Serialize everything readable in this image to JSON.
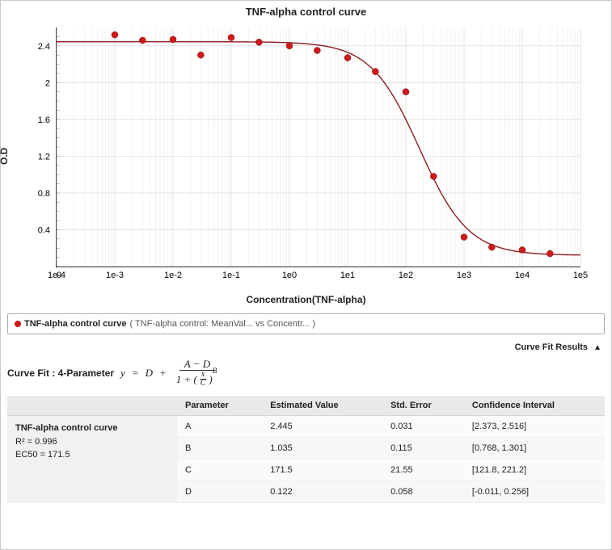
{
  "chart_data": {
    "type": "line",
    "title": "TNF-alpha control curve",
    "xlabel": "Concentration(TNF-alpha)",
    "ylabel": "O.D",
    "x_scale": "log",
    "x_ticks": [
      "1e-4",
      "1e-3",
      "1e-2",
      "1e-1",
      "1e0",
      "1e1",
      "1e2",
      "1e3",
      "1e4",
      "1e5"
    ],
    "y_ticks": [
      "0",
      "0.4",
      "0.8",
      "1.2",
      "1.6",
      "2",
      "2.4"
    ],
    "xlim": [
      0.0001,
      100000
    ],
    "ylim": [
      0,
      2.6
    ],
    "series": [
      {
        "name": "TNF-alpha control curve",
        "color": "#d11919",
        "points": [
          {
            "x": 0.001,
            "y": 2.52
          },
          {
            "x": 0.003,
            "y": 2.46
          },
          {
            "x": 0.01,
            "y": 2.47
          },
          {
            "x": 0.03,
            "y": 2.3
          },
          {
            "x": 0.1,
            "y": 2.49
          },
          {
            "x": 0.3,
            "y": 2.44
          },
          {
            "x": 1,
            "y": 2.4
          },
          {
            "x": 3,
            "y": 2.35
          },
          {
            "x": 10,
            "y": 2.27
          },
          {
            "x": 30,
            "y": 2.12
          },
          {
            "x": 100,
            "y": 1.9
          },
          {
            "x": 300,
            "y": 0.98
          },
          {
            "x": 1000,
            "y": 0.32
          },
          {
            "x": 3000,
            "y": 0.21
          },
          {
            "x": 10000,
            "y": 0.18
          },
          {
            "x": 30000,
            "y": 0.14
          }
        ],
        "fit_model": "4PL",
        "fit_params": {
          "A": 2.445,
          "B": 1.035,
          "C": 171.5,
          "D": 0.122
        }
      }
    ]
  },
  "legend": {
    "name": "TNF-alpha control curve",
    "detail": "( TNF-alpha control:  MeanVal...   vs  Concentr...  )"
  },
  "curve_fit_results_label": "Curve Fit Results",
  "curve_fit_label": "Curve Fit : 4-Parameter",
  "summary": {
    "name": "TNF-alpha control curve",
    "r2_label": "R² = 0.996",
    "ec50_label": "EC50 = 171.5"
  },
  "table": {
    "headers": [
      "Parameter",
      "Estimated Value",
      "Std. Error",
      "Confidence Interval"
    ],
    "rows": [
      {
        "p": "A",
        "est": "2.445",
        "se": "0.031",
        "ci": "[2.373, 2.516]"
      },
      {
        "p": "B",
        "est": "1.035",
        "se": "0.115",
        "ci": "[0.768, 1.301]"
      },
      {
        "p": "C",
        "est": "171.5",
        "se": "21.55",
        "ci": "[121.8, 221.2]"
      },
      {
        "p": "D",
        "est": "0.122",
        "se": "0.058",
        "ci": "[-0.011, 0.256]"
      }
    ]
  }
}
